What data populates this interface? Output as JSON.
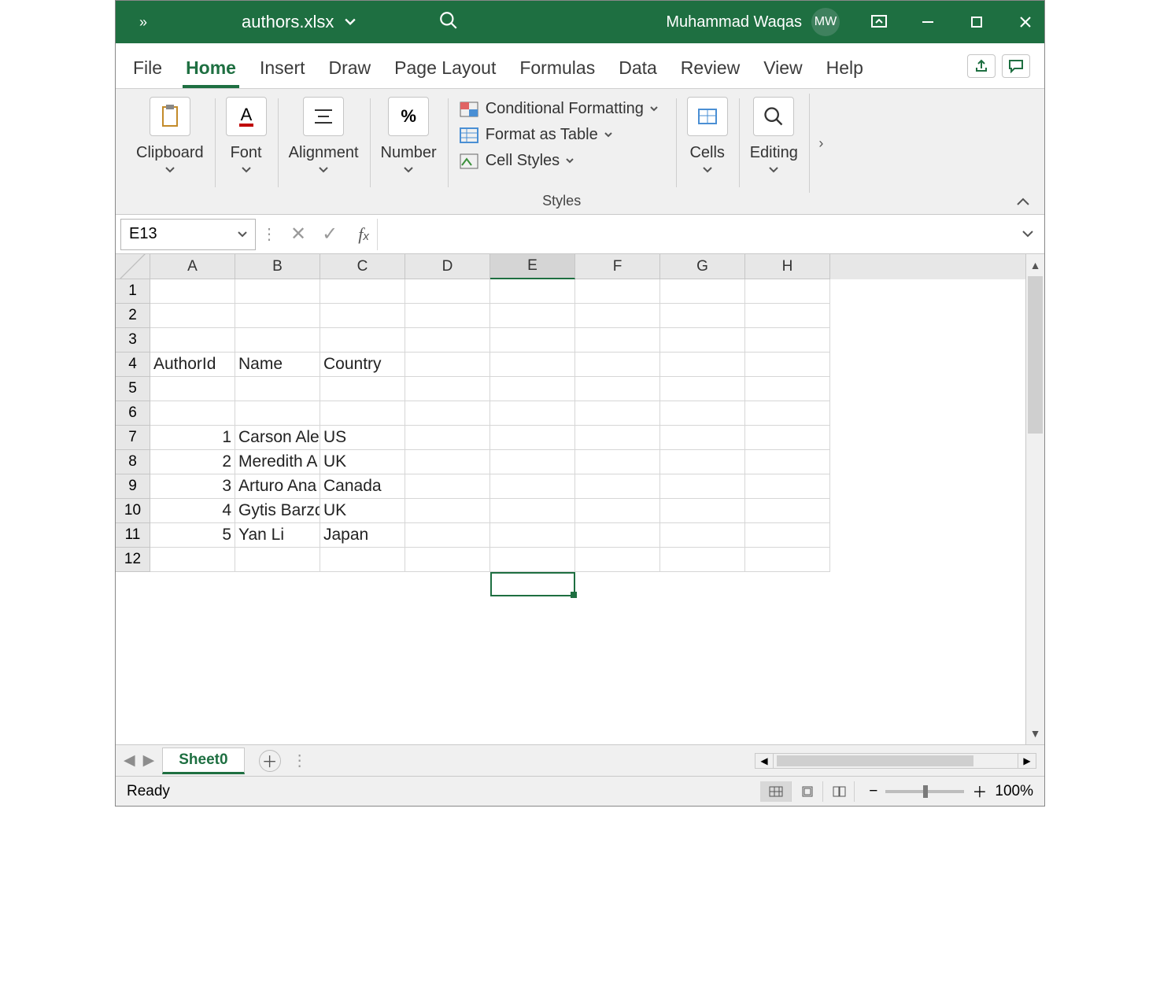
{
  "titlebar": {
    "filename": "authors.xlsx",
    "user_name": "Muhammad Waqas",
    "user_initials": "MW"
  },
  "tabs": {
    "file": "File",
    "home": "Home",
    "insert": "Insert",
    "draw": "Draw",
    "page_layout": "Page Layout",
    "formulas": "Formulas",
    "data": "Data",
    "review": "Review",
    "view": "View",
    "help": "Help"
  },
  "ribbon": {
    "clipboard": "Clipboard",
    "font": "Font",
    "alignment": "Alignment",
    "number": "Number",
    "styles": "Styles",
    "cells": "Cells",
    "editing": "Editing",
    "cond_fmt": "Conditional Formatting",
    "fmt_table": "Format as Table",
    "cell_styles": "Cell Styles"
  },
  "namebox": "E13",
  "columns": [
    "A",
    "B",
    "C",
    "D",
    "E",
    "F",
    "G",
    "H"
  ],
  "row_hdrs": [
    "1",
    "2",
    "3",
    "4",
    "5",
    "6",
    "7",
    "8",
    "9",
    "10",
    "11",
    "12"
  ],
  "cells": {
    "A4": "AuthorId",
    "B4": "Name",
    "C4": "Country",
    "A7": "1",
    "B7": "Carson Ale",
    "C7": "US",
    "A8": "2",
    "B8": "Meredith A",
    "C8": "UK",
    "A9": "3",
    "B9": "Arturo Ana",
    "C9": "Canada",
    "A10": "4",
    "B10": "Gytis Barzd",
    "C10": "UK",
    "A11": "5",
    "B11": "Yan Li",
    "C11": "Japan"
  },
  "sheet_tab": "Sheet0",
  "status": {
    "ready": "Ready",
    "zoom": "100%"
  }
}
